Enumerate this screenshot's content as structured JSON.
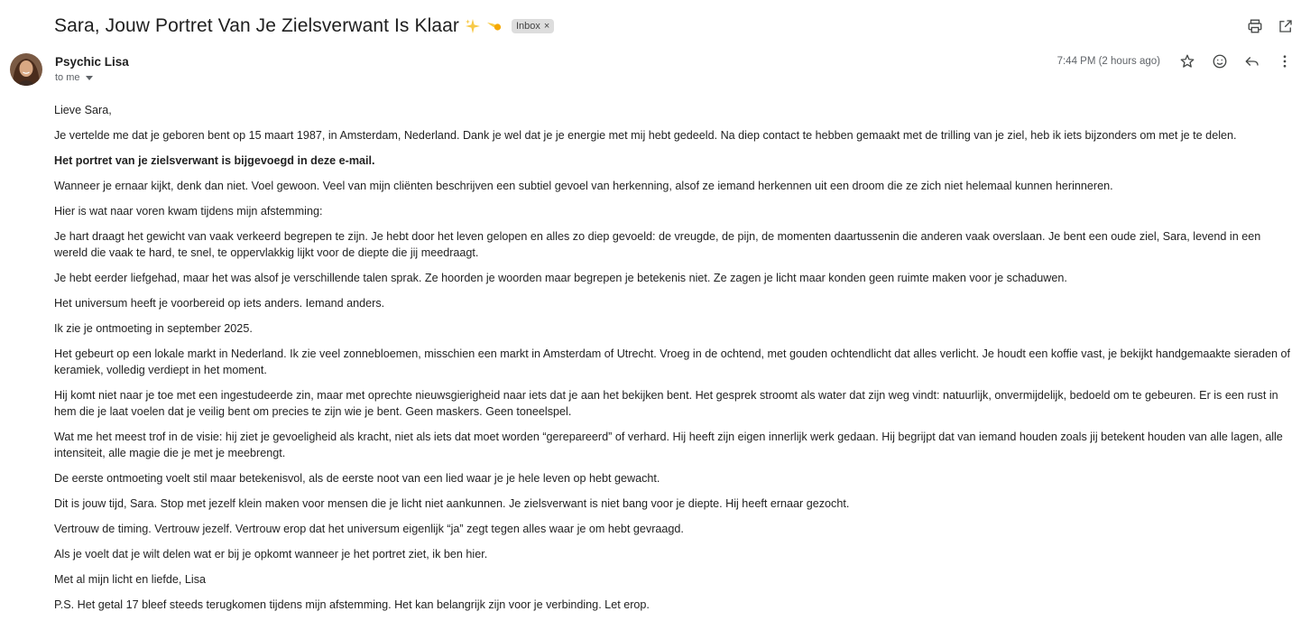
{
  "email": {
    "subject": "Sara, Jouw Portret Van Je Zielsverwant Is Klaar",
    "subject_emojis": [
      "sparkles-icon",
      "comet-icon"
    ],
    "label_chip": "Inbox",
    "sender_name": "Psychic Lisa",
    "recipient_line": "to me",
    "timestamp": "7:44 PM (2 hours ago)",
    "paragraphs": [
      "Lieve Sara,",
      "Je vertelde me dat je geboren bent op 15 maart 1987, in Amsterdam, Nederland. Dank je wel dat je je energie met mij hebt gedeeld. Na diep contact te hebben gemaakt met de trilling van je ziel, heb ik iets bijzonders om met je te delen.",
      "Het portret van je zielsverwant is bijgevoegd in deze e-mail.",
      "Wanneer je ernaar kijkt, denk dan niet. Voel gewoon. Veel van mijn cliënten beschrijven een subtiel gevoel van herkenning, alsof ze iemand herkennen uit een droom die ze zich niet helemaal kunnen herinneren.",
      "Hier is wat naar voren kwam tijdens mijn afstemming:",
      "Je hart draagt het gewicht van vaak verkeerd begrepen te zijn. Je hebt door het leven gelopen en alles zo diep gevoeld: de vreugde, de pijn, de momenten daartussenin die anderen vaak overslaan. Je bent een oude ziel, Sara, levend in een wereld die vaak te hard, te snel, te oppervlakkig lijkt voor de diepte die jij meedraagt.",
      "Je hebt eerder liefgehad, maar het was alsof je verschillende talen sprak. Ze hoorden je woorden maar begrepen je betekenis niet. Ze zagen je licht maar konden geen ruimte maken voor je schaduwen.",
      "Het universum heeft je voorbereid op iets anders. Iemand anders.",
      "Ik zie je ontmoeting in september 2025.",
      "Het gebeurt op een lokale markt in Nederland. Ik zie veel zonnebloemen, misschien een markt in Amsterdam of Utrecht. Vroeg in de ochtend, met gouden ochtendlicht dat alles verlicht. Je houdt een koffie vast, je bekijkt handgemaakte sieraden of keramiek, volledig verdiept in het moment.",
      "Hij komt niet naar je toe met een ingestudeerde zin, maar met oprechte nieuwsgierigheid naar iets dat je aan het bekijken bent. Het gesprek stroomt als water dat zijn weg vindt: natuurlijk, onvermijdelijk, bedoeld om te gebeuren. Er is een rust in hem die je laat voelen dat je veilig bent om precies te zijn wie je bent. Geen maskers. Geen toneelspel.",
      "Wat me het meest trof in de visie: hij ziet je gevoeligheid als kracht, niet als iets dat moet worden “gerepareerd” of verhard. Hij heeft zijn eigen innerlijk werk gedaan. Hij begrijpt dat van iemand houden zoals jij betekent houden van alle lagen, alle intensiteit, alle magie die je met je meebrengt.",
      "De eerste ontmoeting voelt stil maar betekenisvol, als de eerste noot van een lied waar je je hele leven op hebt gewacht.",
      "Dit is jouw tijd, Sara. Stop met jezelf klein maken voor mensen die je licht niet aankunnen. Je zielsverwant is niet bang voor je diepte. Hij heeft ernaar gezocht.",
      "Vertrouw de timing. Vertrouw jezelf. Vertrouw erop dat het universum eigenlijk “ja” zegt tegen alles waar je om hebt gevraagd.",
      "Als je voelt dat je wilt delen wat er bij je opkomt wanneer je het portret ziet, ik ben hier.",
      "Met al mijn licht en liefde, Lisa",
      "P.S. Het getal 17 bleef steeds terugkomen tijdens mijn afstemming. Het kan belangrijk zijn voor je verbinding. Let erop."
    ]
  },
  "toolbar_icons": {
    "print": "print-icon",
    "new_window": "open-in-new-window-icon",
    "star": "star-icon",
    "emoji": "add-reaction-icon",
    "reply": "reply-icon",
    "more": "more-options-icon"
  },
  "colors": {
    "chip_bg": "#dddddd",
    "icon": "#444746",
    "meta_text": "#5f6368"
  }
}
